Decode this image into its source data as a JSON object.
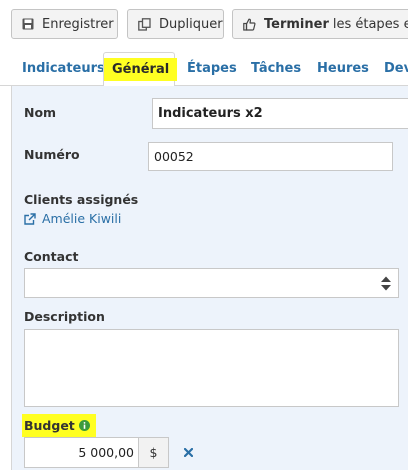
{
  "toolbar": {
    "save_label": "Enregistrer",
    "duplicate_label": "Dupliquer",
    "finish_bold": "Terminer",
    "finish_rest": "les étapes et les"
  },
  "tabs": [
    {
      "label": "Indicateurs"
    },
    {
      "label": "Général",
      "active": true
    },
    {
      "label": "Étapes"
    },
    {
      "label": "Tâches"
    },
    {
      "label": "Heures"
    },
    {
      "label": "Dev"
    }
  ],
  "form": {
    "name_label": "Nom",
    "name_value": "Indicateurs x2",
    "number_label": "Numéro",
    "number_value": "00052",
    "clients_label": "Clients assignés",
    "client_link": "Amélie Kiwili",
    "contact_label": "Contact",
    "contact_value": "",
    "description_label": "Description",
    "budget_label": "Budget",
    "budget_value": "5 000,00",
    "currency": "$"
  },
  "colors": {
    "link": "#2a6fa6",
    "highlight": "#ffff22",
    "panel_bg": "#edf3fb",
    "info_icon": "#3c9a3c",
    "clear_icon": "#2a6fa6"
  },
  "icons": {
    "save": "floppy-disk-icon",
    "duplicate": "copy-icon",
    "finish": "thumbs-up-icon",
    "external_link": "external-link-icon",
    "select": "sort-arrows-icon",
    "info": "info-circle-icon",
    "clear": "close-icon"
  }
}
